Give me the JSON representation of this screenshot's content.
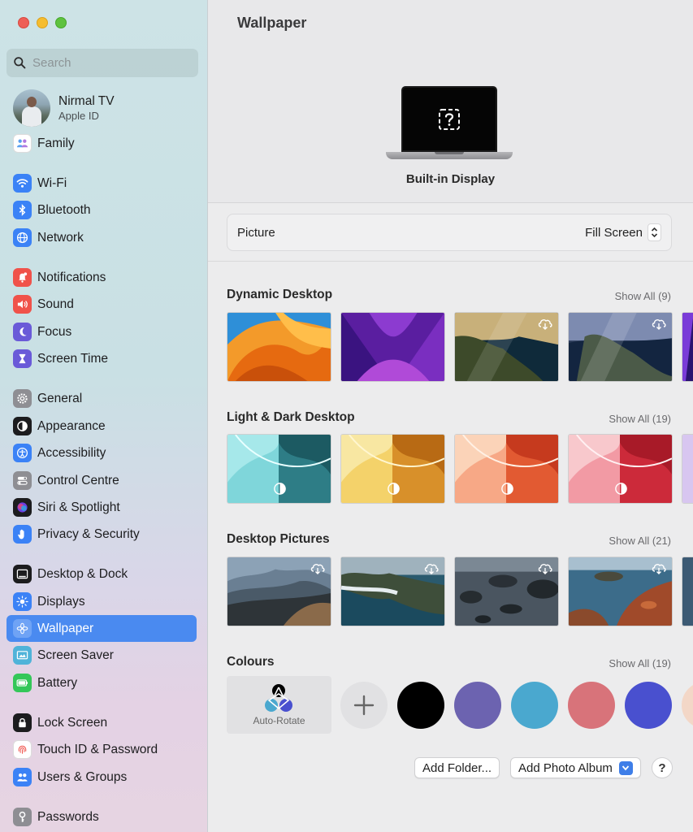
{
  "sidebar": {
    "search_placeholder": "Search",
    "account": {
      "name": "Nirmal TV",
      "subtitle": "Apple ID"
    },
    "items": [
      {
        "label": "Family",
        "icon": "family-icon",
        "color": "#ffffff"
      },
      {
        "label": "Wi-Fi",
        "icon": "wifi-icon",
        "color": "#3b82f6"
      },
      {
        "label": "Bluetooth",
        "icon": "bluetooth-icon",
        "color": "#3b82f6"
      },
      {
        "label": "Network",
        "icon": "globe-icon",
        "color": "#3b82f6"
      },
      {
        "label": "Notifications",
        "icon": "bell-icon",
        "color": "#f0524a"
      },
      {
        "label": "Sound",
        "icon": "speaker-icon",
        "color": "#f0524a"
      },
      {
        "label": "Focus",
        "icon": "moon-icon",
        "color": "#6a5ad8"
      },
      {
        "label": "Screen Time",
        "icon": "hourglass-icon",
        "color": "#6a5ad8"
      },
      {
        "label": "General",
        "icon": "gear-icon",
        "color": "#8e8e93"
      },
      {
        "label": "Appearance",
        "icon": "appearance-icon",
        "color": "#1c1c1e"
      },
      {
        "label": "Accessibility",
        "icon": "accessibility-icon",
        "color": "#3b82f6"
      },
      {
        "label": "Control Centre",
        "icon": "toggles-icon",
        "color": "#8e8e93"
      },
      {
        "label": "Siri & Spotlight",
        "icon": "siri-icon",
        "color": "#1c1c1e"
      },
      {
        "label": "Privacy & Security",
        "icon": "hand-icon",
        "color": "#3b82f6"
      },
      {
        "label": "Desktop & Dock",
        "icon": "dock-icon",
        "color": "#1c1c1e"
      },
      {
        "label": "Displays",
        "icon": "brightness-icon",
        "color": "#3b82f6"
      },
      {
        "label": "Wallpaper",
        "icon": "flower-icon",
        "color": "#4a8af0"
      },
      {
        "label": "Screen Saver",
        "icon": "screensaver-icon",
        "color": "#4fb3d9"
      },
      {
        "label": "Battery",
        "icon": "battery-icon",
        "color": "#34c759"
      },
      {
        "label": "Lock Screen",
        "icon": "lock-icon",
        "color": "#1c1c1e"
      },
      {
        "label": "Touch ID & Password",
        "icon": "fingerprint-icon",
        "color": "#f0524a"
      },
      {
        "label": "Users & Groups",
        "icon": "users-icon",
        "color": "#3b82f6"
      },
      {
        "label": "Passwords",
        "icon": "key-icon",
        "color": "#8e8e93"
      }
    ],
    "selected": "Wallpaper"
  },
  "main": {
    "title": "Wallpaper",
    "display_name": "Built-in Display",
    "picture": {
      "label": "Picture",
      "value": "Fill Screen"
    },
    "sections": [
      {
        "title": "Dynamic Desktop",
        "show_all": "Show All (9)"
      },
      {
        "title": "Light & Dark Desktop",
        "show_all": "Show All (19)"
      },
      {
        "title": "Desktop Pictures",
        "show_all": "Show All (21)"
      },
      {
        "title": "Colours",
        "show_all": "Show All (19)"
      }
    ],
    "colours": {
      "auto_rotate_label": "Auto-Rotate",
      "swatches": [
        "#000000",
        "#6c63b0",
        "#4aa8cf",
        "#d8737a",
        "#4950cf",
        "#f3d7c7"
      ]
    },
    "buttons": {
      "add_folder": "Add Folder...",
      "add_photo_album": "Add Photo Album",
      "help": "?"
    }
  }
}
